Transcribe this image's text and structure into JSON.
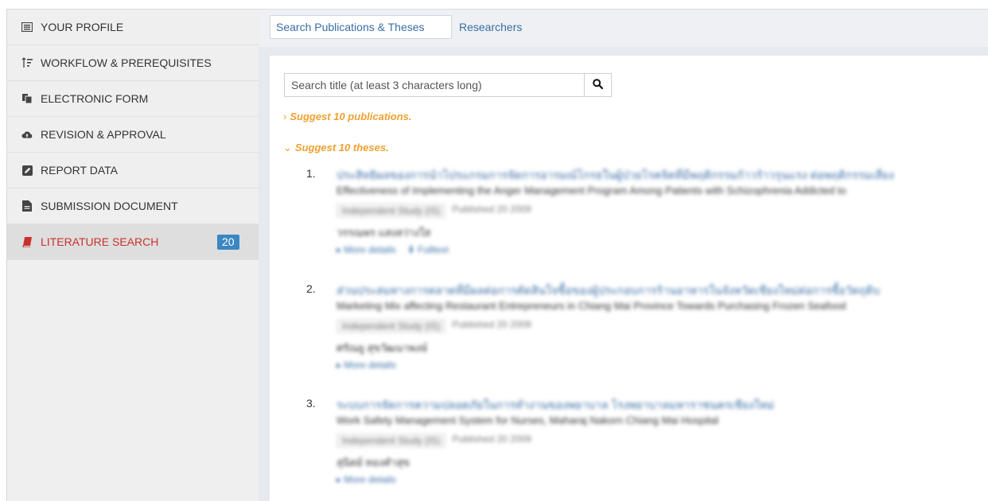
{
  "sidebar": {
    "items": [
      {
        "label": "YOUR PROFILE",
        "icon": "profile-card-icon"
      },
      {
        "label": "WORKFLOW & PREREQUISITES",
        "icon": "sort-order-icon"
      },
      {
        "label": "ELECTRONIC FORM",
        "icon": "copy-form-icon"
      },
      {
        "label": "REVISION & APPROVAL",
        "icon": "cloud-upload-icon"
      },
      {
        "label": "REPORT DATA",
        "icon": "edit-square-icon"
      },
      {
        "label": "SUBMISSION DOCUMENT",
        "icon": "document-icon"
      },
      {
        "label": "LITERATURE SEARCH",
        "icon": "book-icon",
        "badge": "20",
        "active": true
      }
    ],
    "active_color": "#c9302c",
    "badge_color": "#3a87c2"
  },
  "tabs": {
    "active": "Search Publications & Theses",
    "other": "Researchers"
  },
  "search": {
    "placeholder": "Search title (at least 3 characters long)",
    "button_icon": "search-icon"
  },
  "suggest": {
    "publications": "Suggest 10 publications.",
    "theses": "Suggest 10 theses.",
    "publications_caret": "›",
    "theses_caret": "⌄",
    "accent": "#f0a030"
  },
  "results": [
    {
      "num": "1.",
      "title": "ประสิทธิผลของการนำโปรแกรมการจัดการอารมณ์โกรธในผู้ป่วยโรคจิตที่มีพฤติกรรมก้าวร้าวรุนแรง ต่อพฤติกรรมเสี่ยง",
      "subtitle": "Effectiveness of Implementing the Anger Management Program Among Patients with Schizophrenia Addicted to",
      "type": "Independent Study (IS)",
      "published": "Published 20 2009",
      "author": "วรรณพร แสงสว่างใส",
      "links": [
        "▸ More details",
        "⬇ Fulltext"
      ]
    },
    {
      "num": "2.",
      "title": "ส่วนประสมทางการตลาดที่มีผลต่อการตัดสินใจซื้อของผู้ประกอบการร้านอาหารในจังหวัดเชียงใหม่ต่อการซื้อวัตถุดิบ",
      "subtitle": "Marketing Mix affecting Restaurant Entrepreneurs in Chiang Mai Province Towards Purchasing Frozen Seafood",
      "type": "Independent Study (IS)",
      "published": "Published 20 2009",
      "author": "ศรัณยู สุขวัฒนาพงษ์",
      "links": [
        "▸ More details"
      ]
    },
    {
      "num": "3.",
      "title": "ระบบการจัดการความปลอดภัยในการทำงานของพยาบาล โรงพยาบาลมหาราชนครเชียงใหม่",
      "subtitle": "Work Safety Management System for Nurses, Maharaj Nakorn Chiang Mai Hospital",
      "type": "Independent Study (IS)",
      "published": "Published 20 2009",
      "author": "สุนิตย์ ทองคำสุข",
      "links": [
        "▸ More details"
      ]
    }
  ]
}
